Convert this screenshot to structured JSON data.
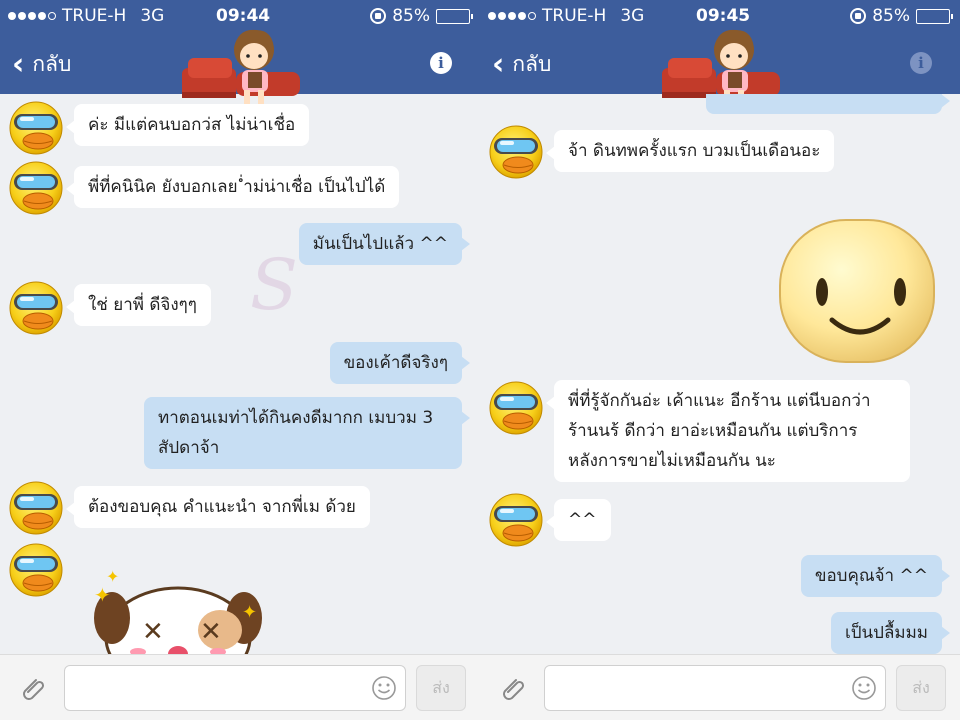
{
  "left": {
    "status": {
      "carrier": "TRUE-H",
      "network": "3G",
      "time": "09:44",
      "battery": "85%",
      "battery_level": 0.85
    },
    "nav": {
      "back_label": "กลับ"
    },
    "messages": [
      {
        "dir": "in",
        "text": "ค่ะ  มีแต่คนบอกว่ส ไม่น่าเชื่อ"
      },
      {
        "dir": "in",
        "text": "พี่ที่คนินิค ยังบอกเลย  ่ำม่น่าเชื่อ เป็นไปได้"
      },
      {
        "dir": "out",
        "text": "มันเป็นไปแล้ว ^^"
      },
      {
        "dir": "in",
        "text": "ใช่  ยาพี่  ดีจิงๆๆ"
      },
      {
        "dir": "out",
        "text": "ของเค้าดีจริงๆ"
      },
      {
        "dir": "out",
        "text": "ทาตอนเมท่าได้กินคงดีมากก เมบวม 3",
        "text2": "สัปดาจ้า"
      },
      {
        "dir": "in",
        "text": "ต้องขอบคุณ  คำแนะนำ จากพี่เม  ด้วย"
      }
    ],
    "input": {
      "send_label": "ส่ง"
    }
  },
  "right": {
    "status": {
      "carrier": "TRUE-H",
      "network": "3G",
      "time": "09:45",
      "battery": "85%",
      "battery_level": 0.85
    },
    "nav": {
      "back_label": "กลับ"
    },
    "messages": [
      {
        "dir": "in",
        "text": "จ้า   ดินทพครั้งแรก บวมเป็นเดือนอะ"
      },
      {
        "dir": "in",
        "text": "พี่ที่รู้จักกันอ่ะ เค้าแนะ อีกร้าน  แต่นีบอกว่า",
        "text2": "ร้านนร้ ดีกว่า ยาอ่ะเหมือนกัน  แต่บริการ",
        "text3": "หลังการขายไม่เหมือนกัน นะ"
      },
      {
        "dir": "in",
        "text": "^^"
      },
      {
        "dir": "out",
        "text": "ขอบคุณจ้า ^^"
      },
      {
        "dir": "out",
        "text": "เป็นปลื้มมม"
      }
    ],
    "input": {
      "send_label": "ส่ง"
    }
  },
  "colors": {
    "header": "#3d5d9c",
    "incoming": "#ffffff",
    "outgoing": "#c7def3",
    "background": "#eef0f3"
  }
}
